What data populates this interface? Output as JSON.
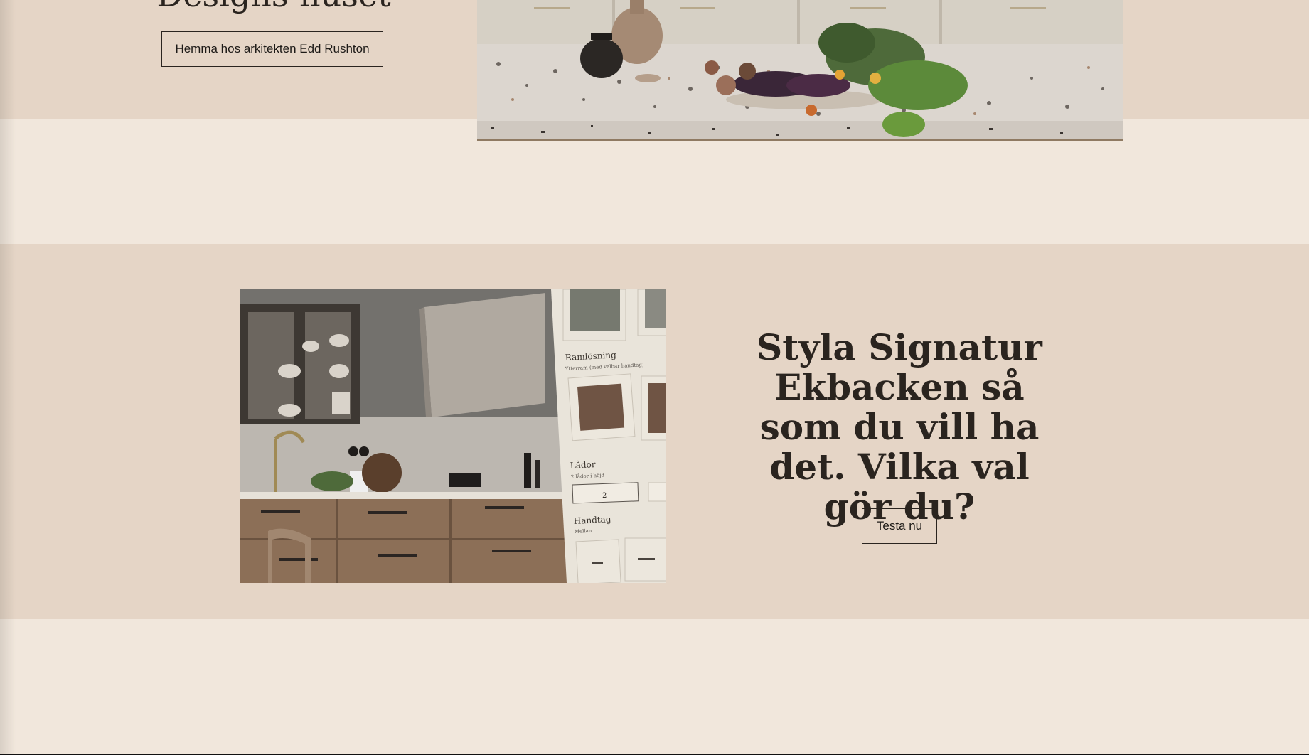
{
  "hero": {
    "title": "Designs-huset",
    "button_label": "Hemma hos arkitekten Edd Rushton",
    "image_icon": "kitchen-countertop-photo"
  },
  "configurator": {
    "title": "Styla Signatur Ekbacken så som du vill ha det. Vilka val gör du?",
    "button_label": "Testa nu",
    "image_icon": "kitchen-configurator-photo",
    "panel": {
      "frame_label": "Ramlösning",
      "frame_sub": "Ytterram (med valbar handtag)",
      "drawers_label": "Lådor",
      "drawers_sub": "2 lådor i höjd",
      "drawers_value": "2",
      "handle_label": "Handtag",
      "handle_sub": "Mellan"
    }
  },
  "colors": {
    "page_bg": "#f1e7dc",
    "section_bg": "#e5d5c6",
    "text": "#2a241f"
  }
}
